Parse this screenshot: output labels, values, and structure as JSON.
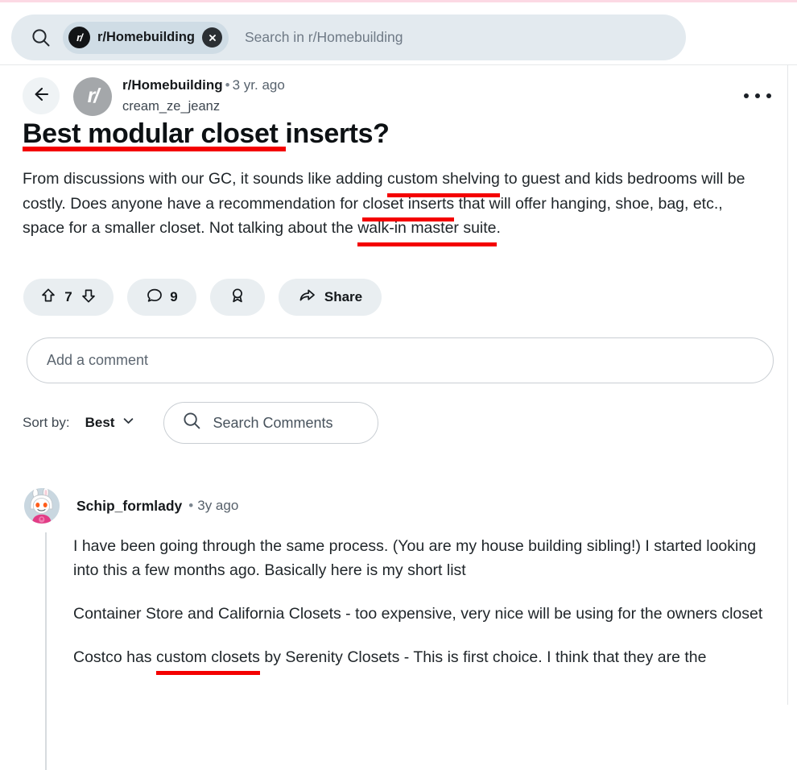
{
  "search": {
    "glass_icon": "search-icon",
    "subreddit_pill": {
      "avatar_text": "r/",
      "label": "r/Homebuilding",
      "close_icon": "close-icon"
    },
    "placeholder": "Search in r/Homebuilding"
  },
  "post": {
    "back_icon": "back-arrow-icon",
    "subreddit_avatar_text": "r/",
    "subreddit": "r/Homebuilding",
    "separator": "•",
    "age": "3 yr. ago",
    "author": "cream_ze_jeanz",
    "more_icon": "overflow-menu-icon",
    "title": "Best modular closet inserts?",
    "body": {
      "seg1": "From discussions with our GC, it sounds like adding ",
      "hl1": "custom shelving",
      "seg2": " to guest and kids bedrooms will be costly. Does anyone have a recommendation for ",
      "hl2": "closet inserts",
      "seg3": " that will offer hanging, shoe, bag, etc., space for a smaller closet. Not talking about the ",
      "hl3": "walk-in master suite",
      "seg4": "."
    },
    "actions": {
      "upvote_icon": "upvote-arrow-icon",
      "score": "7",
      "downvote_icon": "downvote-arrow-icon",
      "comment_icon": "comment-bubble-icon",
      "comment_count": "9",
      "award_icon": "award-ribbon-icon",
      "share_icon": "share-arrow-icon",
      "share_label": "Share"
    }
  },
  "compose": {
    "placeholder": "Add a comment"
  },
  "sort": {
    "label": "Sort by:",
    "value": "Best",
    "chevron_icon": "chevron-down-icon",
    "search_icon": "search-icon",
    "search_placeholder": "Search Comments"
  },
  "comment": {
    "avatar_icon": "user-avatar-snoo",
    "author": "Schip_formlady",
    "separator": "•",
    "age": "3y ago",
    "paragraph1": "I have been going through the same process. (You are my house building sibling!) I started looking into this a few months ago. Basically here is my short list",
    "paragraph2": "Container Store and California Closets - too expensive, very nice will be using for the owners closet",
    "paragraph3": {
      "seg1": "Costco has ",
      "hl1": "custom closets",
      "seg2": " by Serenity Closets - This is first choice. I think that they are the"
    }
  },
  "colors": {
    "annotation_red": "#f40000",
    "pill_gray": "#e9eef1",
    "search_gray": "#e3eaef",
    "accent_pink_hairline": "#fcd9e4"
  }
}
